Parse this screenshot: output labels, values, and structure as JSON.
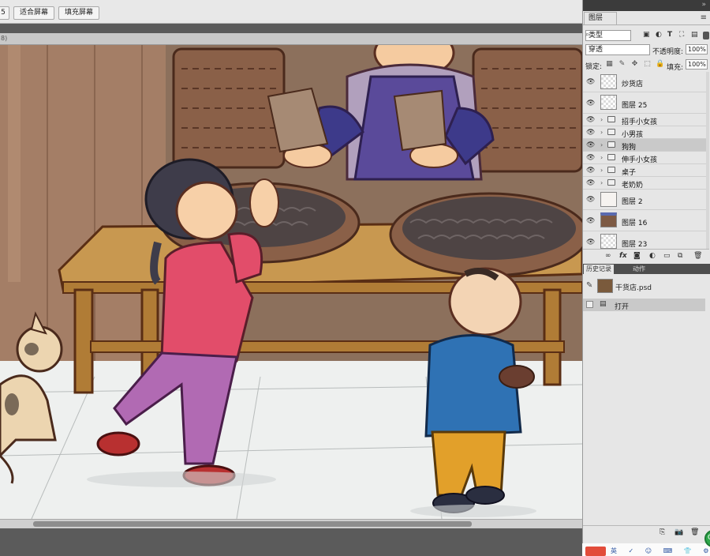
{
  "options_bar": {
    "buttons": [
      "5",
      "适合屏幕",
      "填充屏幕"
    ]
  },
  "document": {
    "tab_fragment": "8)"
  },
  "layers_panel": {
    "tab_label": "图层",
    "menu_icon": "panel-menu-icon",
    "kind_select": "类型",
    "blend_mode": "穿透",
    "opacity_label": "不透明度:",
    "opacity_value": "100%",
    "lock_label": "锁定:",
    "fill_label": "填充:",
    "fill_value": "100%",
    "layers": [
      {
        "name": "炒货店",
        "type": "layer",
        "thumb": "transparent"
      },
      {
        "name": "图层 25",
        "type": "layer",
        "thumb": "transparent"
      },
      {
        "name": "招手小女孩",
        "type": "group"
      },
      {
        "name": "小男孩",
        "type": "group"
      },
      {
        "name": "狗狗",
        "type": "group",
        "selected": true
      },
      {
        "name": "伸手小女孩",
        "type": "group"
      },
      {
        "name": "桌子",
        "type": "group"
      },
      {
        "name": "老奶奶",
        "type": "group"
      },
      {
        "name": "图层 2",
        "type": "layer",
        "thumb": "sketch"
      },
      {
        "name": "图层 16",
        "type": "layer",
        "thumb": "scene"
      },
      {
        "name": "图层 23",
        "type": "layer",
        "thumb": "transparent"
      }
    ],
    "footer_icons": [
      "link-icon",
      "fx-icon",
      "mask-icon",
      "adjustment-icon",
      "folder-icon",
      "new-layer-icon",
      "trash-icon"
    ]
  },
  "history_panel": {
    "tabs": [
      "历史记录",
      "动作"
    ],
    "snapshot_file": "干货店.psd",
    "steps": [
      "打开"
    ]
  },
  "taskbar": {
    "text": "英 ✓ ☺ ⌨ 👕 ⚙"
  },
  "colors": {
    "accent_selected": "#c9c9c9",
    "panel_bg": "#e6e6e6",
    "workspace": "#535353"
  }
}
